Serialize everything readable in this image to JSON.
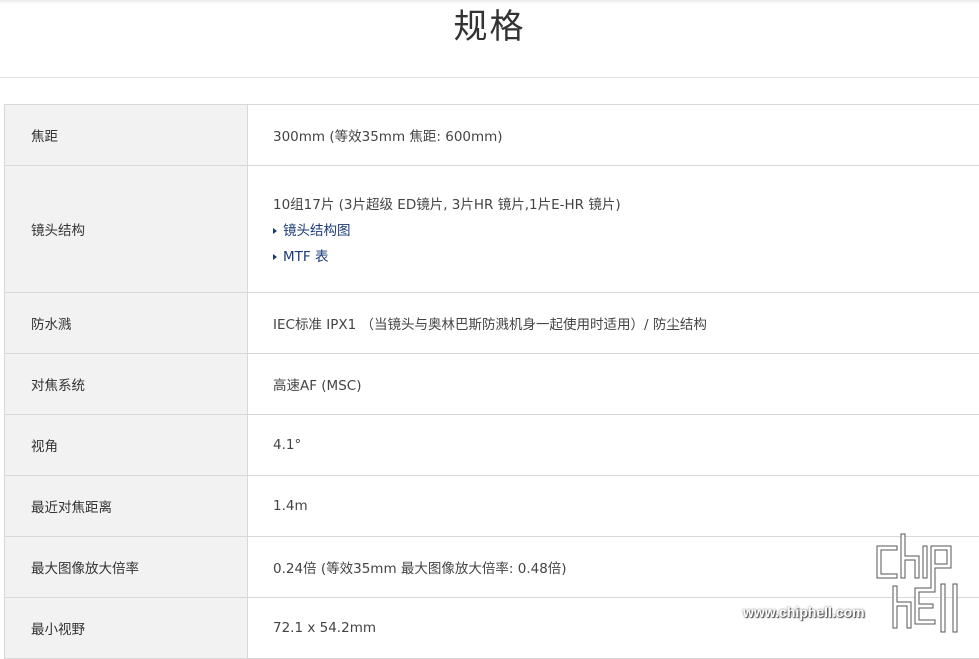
{
  "page": {
    "title": "规格"
  },
  "specs": [
    {
      "label": "焦距",
      "value": "300mm (等效35mm 焦距: 600mm)"
    },
    {
      "label": "镜头结构",
      "value": "10组17片 (3片超级 ED镜片, 3片HR 镜片,1片E-HR 镜片)",
      "links": [
        "镜头结构图",
        "MTF 表"
      ]
    },
    {
      "label": "防水溅",
      "value": "IEC标准 IPX1 （当镜头与奥林巴斯防溅机身一起使用时适用）/ 防尘结构"
    },
    {
      "label": "对焦系统",
      "value": "高速AF (MSC)"
    },
    {
      "label": "视角",
      "value": "4.1°"
    },
    {
      "label": "最近对焦距离",
      "value": "1.4m"
    },
    {
      "label": "最大图像放大倍率",
      "value": "0.24倍 (等效35mm 最大图像放大倍率: 0.48倍)"
    },
    {
      "label": "最小视野",
      "value": "72.1 x 54.2mm"
    }
  ],
  "watermark": {
    "logo_text": "chip hell",
    "url": "www.chiphell.com"
  },
  "colors": {
    "label_bg": "#f2f2f2",
    "border": "#d8d8d8",
    "link": "#1a3a7a"
  }
}
